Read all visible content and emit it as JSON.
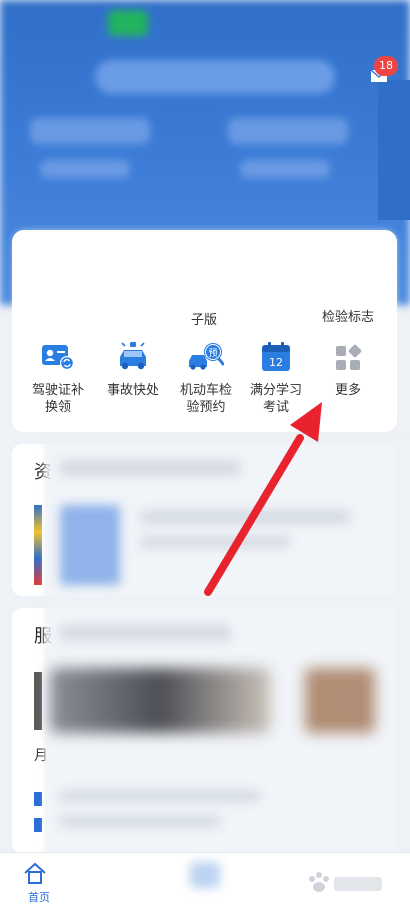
{
  "header": {
    "badge_count": "18"
  },
  "card_partial_labels": {
    "label_1": "子版",
    "label_2": "检验标志"
  },
  "tools": [
    {
      "icon": "license-renewal-icon",
      "label_line1": "驾驶证补",
      "label_line2": "换领"
    },
    {
      "icon": "accident-icon",
      "label_line1": "事故快处",
      "label_line2": ""
    },
    {
      "icon": "inspection-booking-icon",
      "label_line1": "机动车检",
      "label_line2": "验预约"
    },
    {
      "icon": "study-exam-icon",
      "label_line1": "满分学习",
      "label_line2": "考试"
    },
    {
      "icon": "more-icon",
      "label_line1": "更多",
      "label_line2": ""
    }
  ],
  "study_icon_number": "12",
  "booking_icon_badge": "预",
  "sections": {
    "section_1_initial": "资",
    "section_2_initial": "服",
    "section_2_letter": "月"
  },
  "tabbar": {
    "home_label": "首页"
  },
  "colors": {
    "brand_blue": "#2f6fc9",
    "icon_blue": "#2a7de1",
    "arrow_red": "#e8232d"
  }
}
